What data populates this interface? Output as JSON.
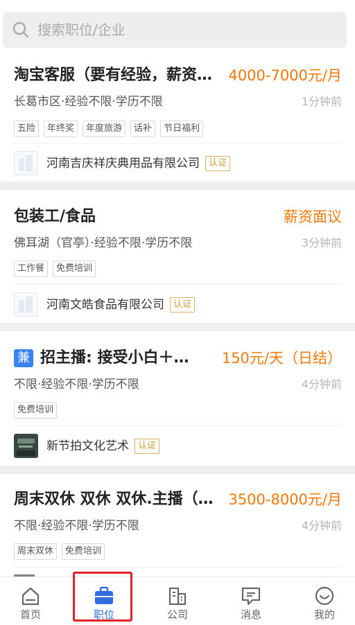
{
  "search": {
    "placeholder": "搜索职位/企业"
  },
  "jobs": [
    {
      "title": "淘宝客服（要有经验，薪资…",
      "salary": "4000-7000元/月",
      "meta": "长葛市区·经验不限·学历不限",
      "time": "1分钟前",
      "tags": [
        "五险",
        "年终奖",
        "年度旅游",
        "话补",
        "节日福利"
      ],
      "company": "河南吉庆祥庆典用品有限公司",
      "verified": "认证"
    },
    {
      "title": "包装工/食品",
      "salary": "薪资面议",
      "meta": "佛耳湖（官亭）·经验不限·学历不限",
      "time": "3分钟前",
      "tags": [
        "工作餐",
        "免费培训"
      ],
      "company": "河南文皓食品有限公司",
      "verified": "认证"
    },
    {
      "badge": "兼",
      "title": "招主播: 接受小白＋露…",
      "salary": "150元/天（日结）",
      "meta": "不限·经验不限·学历不限",
      "time": "4分钟前",
      "tags": [
        "免费培训"
      ],
      "company": "新节拍文化艺术",
      "verified": "认证"
    },
    {
      "title": "周末双休 双休 双休.主播（…",
      "salary": "3500-8000元/月",
      "meta": "不限·经验不限·学历不限",
      "time": "4分钟前",
      "tags": [
        "周末双休",
        "免费培训"
      ]
    }
  ],
  "tabbar": {
    "active": "职位",
    "items": [
      {
        "label": "首页",
        "icon": "home-icon"
      },
      {
        "label": "职位",
        "icon": "briefcase-icon"
      },
      {
        "label": "公司",
        "icon": "building-icon"
      },
      {
        "label": "消息",
        "icon": "message-icon"
      },
      {
        "label": "我的",
        "icon": "profile-smile-icon"
      }
    ]
  },
  "colors": {
    "accent": "#2f6de0",
    "salary": "#f3780a",
    "verified": "#c99b3a",
    "highlight": "#e0202b"
  }
}
